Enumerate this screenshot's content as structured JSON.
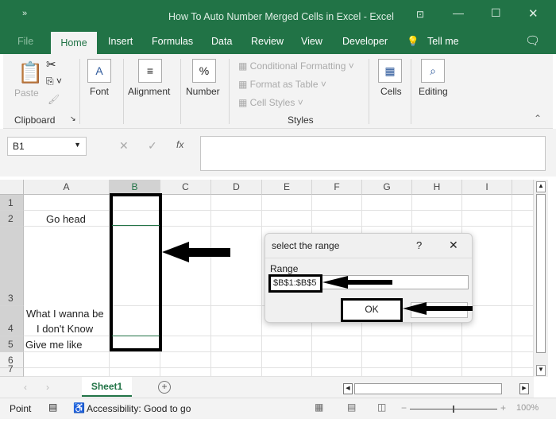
{
  "window": {
    "title": "How To Auto Number Merged Cells in Excel  -  Excel",
    "qat": "»"
  },
  "tabs": [
    "File",
    "Home",
    "Insert",
    "Formulas",
    "Data",
    "Review",
    "View",
    "Developer",
    "Tell me"
  ],
  "ribbon": {
    "clipboard": {
      "paste": "Paste",
      "group": "Clipboard"
    },
    "font": "Font",
    "alignment": "Alignment",
    "number": "Number",
    "styles": {
      "conditional": "Conditional Formatting",
      "format_table": "Format as Table",
      "cell_styles": "Cell Styles",
      "group": "Styles"
    },
    "cells": "Cells",
    "editing": "Editing"
  },
  "formula_bar": {
    "name_box": "B1",
    "fx": "fx",
    "value": ""
  },
  "columns": [
    "A",
    "B",
    "C",
    "D",
    "E",
    "F",
    "G",
    "H",
    "I"
  ],
  "rows": [
    "1",
    "2",
    "3",
    "4",
    "5",
    "6",
    "7"
  ],
  "cells": {
    "A2": "Go head",
    "A4_line1": "What I wanna be",
    "A4_line2": "I don't Know",
    "A5": "Give me like"
  },
  "dialog": {
    "title": "select the range",
    "help": "?",
    "close": "✕",
    "label": "Range",
    "value": "$B$1:$B$5",
    "ok": "OK",
    "cancel": ""
  },
  "sheet_tabs": {
    "active": "Sheet1",
    "add": "+"
  },
  "status": {
    "mode": "Point",
    "accessibility": "Accessibility: Good to go",
    "zoom": "100%"
  }
}
